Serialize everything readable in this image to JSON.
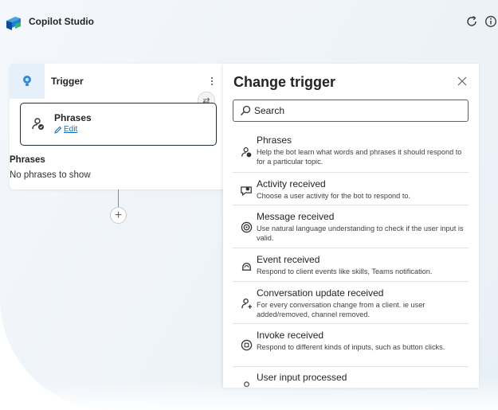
{
  "app": {
    "title": "Copilot Studio",
    "accent": "#0f6cbd"
  },
  "canvas": {
    "trigger_label": "Trigger",
    "phrases_title": "Phrases",
    "edit_label": "Edit",
    "phrases_heading": "Phrases",
    "phrases_empty": "No phrases to show"
  },
  "panel": {
    "title": "Change trigger",
    "search_placeholder": "Search",
    "items": [
      {
        "icon": "phrases-icon",
        "title": "Phrases",
        "desc": "Help the bot learn what words and phrases it should respond to for a particular topic."
      },
      {
        "icon": "activity-icon",
        "title": "Activity received",
        "desc": "Choose a user activity for the bot to respond to."
      },
      {
        "icon": "message-icon",
        "title": "Message received",
        "desc": "Use natural language understanding to check if the user input is valid."
      },
      {
        "icon": "event-icon",
        "title": "Event received",
        "desc": "Respond to client events like skills, Teams notification."
      },
      {
        "icon": "conversation-update-icon",
        "title": "Conversation update received",
        "desc": "For every conversation change from a client. ie user added/removed, channel removed."
      },
      {
        "icon": "invoke-icon",
        "title": "Invoke received",
        "desc": "Respond to different kinds of inputs, such as button clicks."
      },
      {
        "icon": "user-input-icon",
        "title": "User input processed",
        "desc": ""
      }
    ]
  }
}
